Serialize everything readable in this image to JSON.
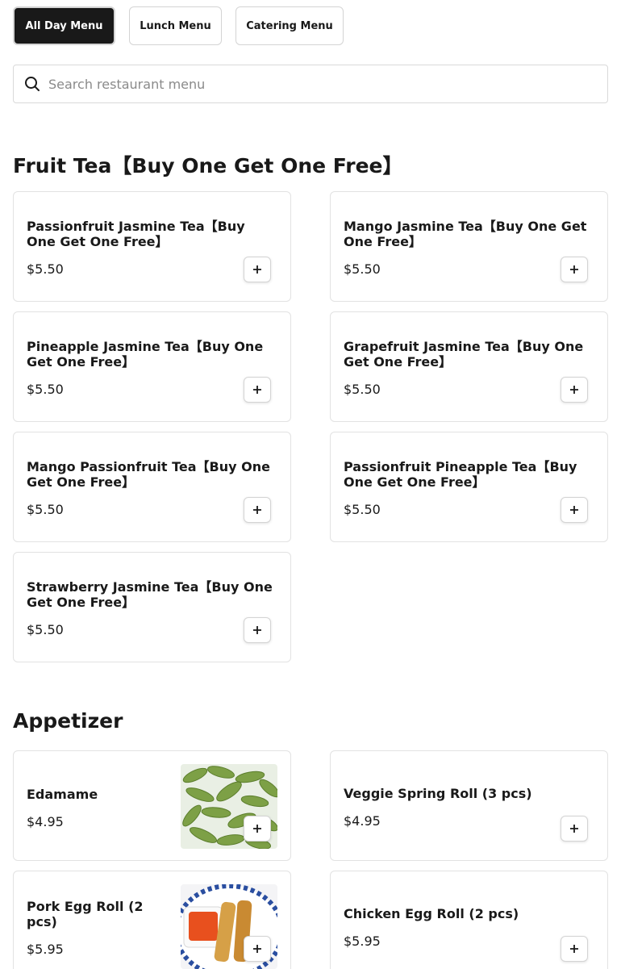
{
  "tabs": [
    {
      "label": "All Day Menu",
      "active": true
    },
    {
      "label": "Lunch Menu",
      "active": false
    },
    {
      "label": "Catering Menu",
      "active": false
    }
  ],
  "search": {
    "placeholder": "Search restaurant menu"
  },
  "sections": [
    {
      "title": "Fruit Tea【Buy One Get One Free】",
      "items": [
        {
          "name": "Passionfruit Jasmine Tea【Buy One Get One Free】",
          "price": "$5.50"
        },
        {
          "name": "Mango Jasmine Tea【Buy One Get One Free】",
          "price": "$5.50"
        },
        {
          "name": "Pineapple Jasmine Tea【Buy One Get One Free】",
          "price": "$5.50"
        },
        {
          "name": "Grapefruit Jasmine Tea【Buy One Get One Free】",
          "price": "$5.50"
        },
        {
          "name": "Mango Passionfruit Tea【Buy One Get One Free】",
          "price": "$5.50"
        },
        {
          "name": "Passionfruit Pineapple Tea【Buy One Get One Free】",
          "price": "$5.50"
        },
        {
          "name": "Strawberry Jasmine Tea【Buy One Get One Free】",
          "price": "$5.50"
        }
      ]
    },
    {
      "title": "Appetizer",
      "items": [
        {
          "name": "Edamame",
          "price": "$4.95",
          "image": "edamame-photo"
        },
        {
          "name": "Veggie Spring Roll (3 pcs)",
          "price": "$4.95"
        },
        {
          "name": "Pork Egg Roll (2 pcs)",
          "price": "$5.95",
          "image": "egg-roll-photo"
        },
        {
          "name": "Chicken Egg Roll (2 pcs)",
          "price": "$5.95"
        }
      ]
    }
  ],
  "icons": {
    "search": "search-icon",
    "add": "plus-icon"
  },
  "colors": {
    "active_tab_bg": "#191919",
    "border": "#e2e2e2",
    "text": "#191919",
    "placeholder": "#8a8a8a"
  }
}
